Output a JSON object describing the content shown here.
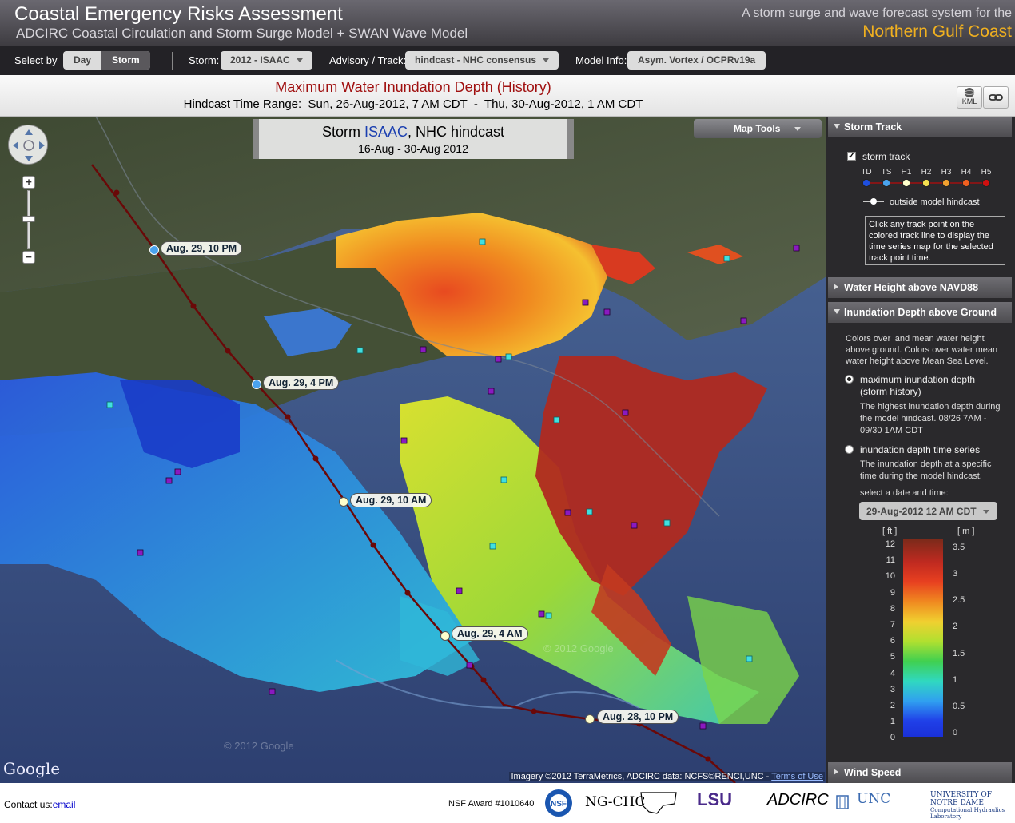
{
  "header": {
    "title": "Coastal Emergency Risks Assessment",
    "subtitle": "ADCIRC Coastal Circulation and Storm Surge Model + SWAN Wave Model",
    "tagline": "A storm surge and wave forecast system for the",
    "region": "Northern Gulf Coast"
  },
  "toolbar": {
    "select_by_label": "Select by",
    "day_label": "Day",
    "storm_label": "Storm",
    "storm_field_label": "Storm:",
    "storm_value": "2012 - ISAAC",
    "advisory_label": "Advisory / Track:",
    "advisory_value": "hindcast - NHC consensus",
    "model_label": "Model Info:",
    "model_value": "Asym. Vortex / OCPRv19a"
  },
  "titlebar": {
    "map_title": "Maximum Water Inundation Depth (History)",
    "time_range": "Hindcast Time Range:  Sun, 26-Aug-2012, 7 AM CDT  -  Thu, 30-Aug-2012, 1 AM CDT",
    "kml_label": "KML"
  },
  "map": {
    "storm_prefix": "Storm ",
    "storm_name": "ISAAC",
    "storm_suffix": ", NHC hindcast",
    "storm_dates": "16-Aug - 30-Aug 2012",
    "map_tools_label": "Map Tools",
    "track_labels": [
      "Aug. 29, 10 PM",
      "Aug. 29, 4 PM",
      "Aug. 29, 10 AM",
      "Aug. 29, 4 AM",
      "Aug. 28, 10 PM"
    ],
    "attribution": "Imagery ©2012 TerraMetrics, ADCIRC data: NCFS©RENCI,UNC - ",
    "terms_label": "Terms of Use",
    "google_label": "Google",
    "watermark": "© 2012 Google"
  },
  "sidebar": {
    "storm_track_title": "Storm Track",
    "storm_track_checkbox": "storm track",
    "categories": [
      "TD",
      "TS",
      "H1",
      "H2",
      "H3",
      "H4",
      "H5"
    ],
    "category_colors": [
      "#1e4fe0",
      "#4aa3ee",
      "#ffffcc",
      "#f5e050",
      "#f0a030",
      "#f06020",
      "#d01010"
    ],
    "outside_label": "outside model hindcast",
    "info_text": "Click any track point on the colored track line to display the time series map for the selected track point time.",
    "water_height_title": "Water Height above NAVD88",
    "inundation_title": "Inundation Depth above Ground",
    "inundation_desc": "Colors over land mean water height above ground. Colors over water mean water height above Mean Sea Level.",
    "max_option_title": "maximum inundation depth (storm history)",
    "max_option_desc": "The highest inundation depth during the model hindcast. 08/26 7AM - 09/30 1AM CDT",
    "ts_option_title": "inundation depth time series",
    "ts_option_desc": "The inundation depth at a specific time during the model hindcast.",
    "select_label": "select a date and time:",
    "select_value": "29-Aug-2012 12 AM CDT",
    "legend_ft_label": "[ ft ]",
    "legend_m_label": "[ m ]",
    "legend_ft_ticks": [
      "12",
      "11",
      "10",
      "9",
      "8",
      "7",
      "6",
      "5",
      "4",
      "3",
      "2",
      "1",
      "0"
    ],
    "legend_m_ticks": [
      "3.5",
      "3",
      "2.5",
      "2",
      "1.5",
      "1",
      "0.5",
      "0"
    ],
    "wind_speed_title": "Wind Speed"
  },
  "footer": {
    "contact_label": "Contact us:",
    "contact_link": "email",
    "nsf_award": "NSF Award #1010640",
    "ngchc": "NG-CHC",
    "lsu": "LSU",
    "adcirc": "ADCIRC",
    "unc": "UNC",
    "notre_dame": "UNIVERSITY OF NOTRE DAME",
    "nd_sub": "Computational Hydraulics Laboratory"
  }
}
